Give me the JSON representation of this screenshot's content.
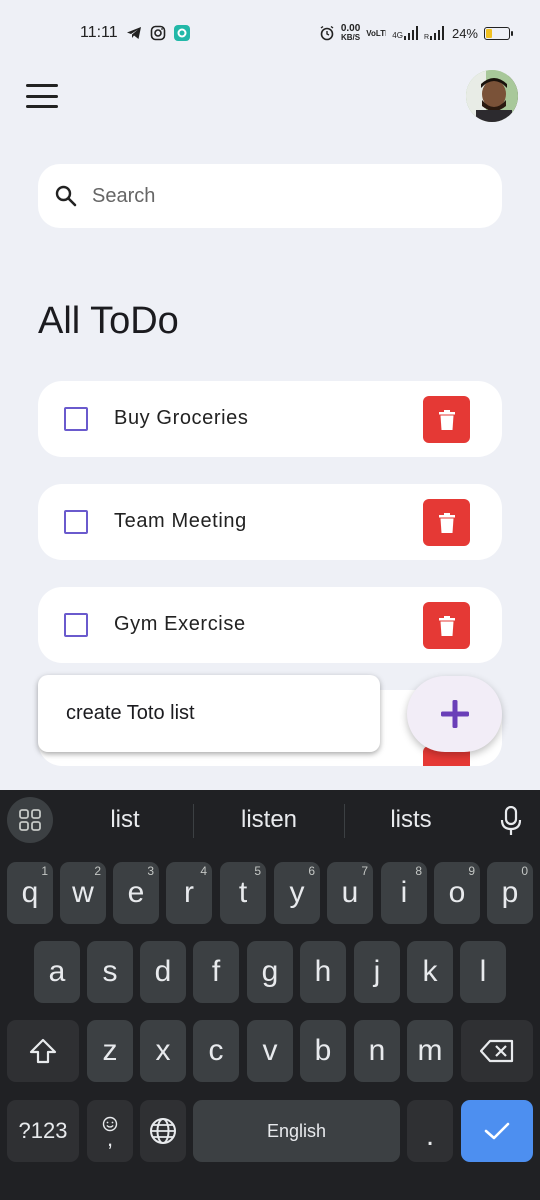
{
  "status_bar": {
    "time": "11:11",
    "net_speed_top": "0.00",
    "net_speed_unit": "KB/S",
    "volte": "VoLTE",
    "network": "4G",
    "battery_percent": "24%",
    "battery_level": 0.24
  },
  "app_bar": {
    "menu_icon": "hamburger-menu-icon",
    "avatar_icon": "user-avatar"
  },
  "search": {
    "placeholder": "Search",
    "icon": "search-icon"
  },
  "page_title": "All ToDo",
  "todos": [
    {
      "label": "Buy Groceries",
      "checked": false
    },
    {
      "label": "Team Meeting",
      "checked": false
    },
    {
      "label": "Gym Exercise",
      "checked": false
    }
  ],
  "new_todo": {
    "value": "create Toto list"
  },
  "fab": {
    "icon": "plus-icon",
    "color": "#6a3fb8"
  },
  "colors": {
    "accent": "#6a5acd",
    "delete": "#e53935",
    "background": "#eef0f6"
  },
  "keyboard": {
    "suggestions": [
      "list",
      "listen",
      "lists"
    ],
    "row1": [
      "q",
      "w",
      "e",
      "r",
      "t",
      "y",
      "u",
      "i",
      "o",
      "p"
    ],
    "row1_nums": [
      "1",
      "2",
      "3",
      "4",
      "5",
      "6",
      "7",
      "8",
      "9",
      "0"
    ],
    "row2": [
      "a",
      "s",
      "d",
      "f",
      "g",
      "h",
      "j",
      "k",
      "l"
    ],
    "row3": [
      "z",
      "x",
      "c",
      "v",
      "b",
      "n",
      "m"
    ],
    "symbols_key": "?123",
    "comma_key": ",",
    "space_label": "English",
    "period_key": "."
  }
}
